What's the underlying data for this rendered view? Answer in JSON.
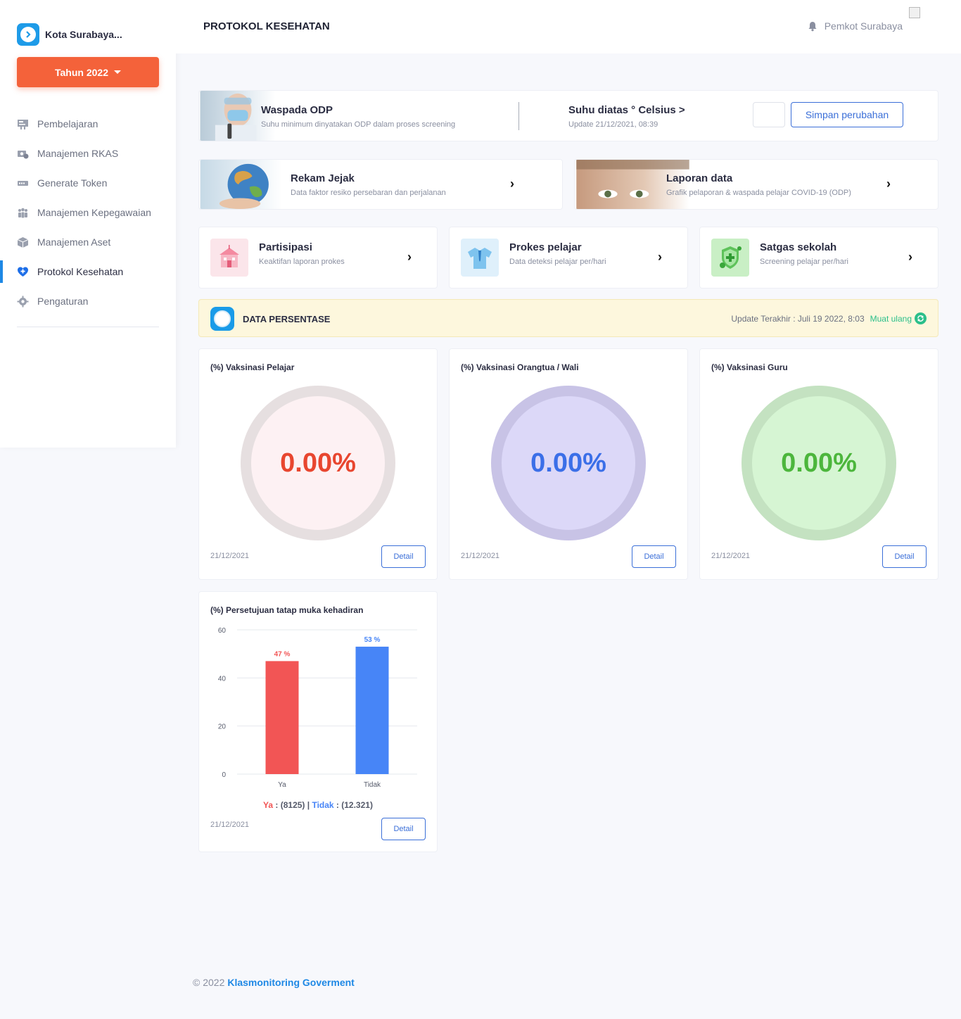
{
  "brand": {
    "name": "Kota Surabaya..."
  },
  "year_button": {
    "label": "Tahun 2022"
  },
  "sidebar": {
    "items": [
      {
        "label": "Pembelajaran",
        "icon": "board-icon",
        "active": false
      },
      {
        "label": "Manajemen RKAS",
        "icon": "money-icon",
        "active": false
      },
      {
        "label": "Generate Token",
        "icon": "ticket-icon",
        "active": false
      },
      {
        "label": "Manajemen Kepegawaian",
        "icon": "people-icon",
        "active": false
      },
      {
        "label": "Manajemen Aset",
        "icon": "box-icon",
        "active": false
      },
      {
        "label": "Protokol Kesehatan",
        "icon": "heart-plus-icon",
        "active": true
      },
      {
        "label": "Pengaturan",
        "icon": "gear-icon",
        "active": false
      }
    ]
  },
  "header": {
    "title": "PROTOKOL KESEHATAN",
    "user": "Pemkot Surabaya"
  },
  "odp": {
    "title": "Waspada ODP",
    "subtitle": "Suhu minimum dinyatakan ODP dalam proses screening",
    "temp_title": "Suhu diatas ° Celsius >",
    "temp_update": "Update 21/12/2021, 08:39",
    "input_value": "",
    "save_label": "Simpan perubahan"
  },
  "wide_cards": [
    {
      "title": "Rekam Jejak",
      "subtitle": "Data faktor resiko persebaran dan perjalanan"
    },
    {
      "title": "Laporan data",
      "subtitle": "Grafik pelaporan & waspada pelajar COVID-19 (ODP)"
    }
  ],
  "menu_cards": [
    {
      "title": "Partisipasi",
      "subtitle": "Keaktifan laporan prokes",
      "icon": "school-icon"
    },
    {
      "title": "Prokes pelajar",
      "subtitle": "Data deteksi pelajar per/hari",
      "icon": "shirt-icon"
    },
    {
      "title": "Satgas sekolah",
      "subtitle": "Screening pelajar per/hari",
      "icon": "shield-virus-icon"
    }
  ],
  "banner": {
    "title": "DATA PERSENTASE",
    "update": "Update Terakhir : Juli 19 2022, 8:03",
    "reload": "Muat ulang"
  },
  "gauges": [
    {
      "title": "(%) Vaksinasi Pelajar",
      "value": "0.00%",
      "date": "21/12/2021",
      "detail": "Detail",
      "colors": {
        "ring": "#e6dfe0",
        "fill": "#fdf1f3",
        "text": "#e8462f"
      }
    },
    {
      "title": "(%) Vaksinasi Orangtua / Wali",
      "value": "0.00%",
      "date": "21/12/2021",
      "detail": "Detail",
      "colors": {
        "ring": "#c8c3e6",
        "fill": "#dcd8f8",
        "text": "#3b6fe8"
      }
    },
    {
      "title": "(%) Vaksinasi Guru",
      "value": "0.00%",
      "date": "21/12/2021",
      "detail": "Detail",
      "colors": {
        "ring": "#c4e2c1",
        "fill": "#d6f5d3",
        "text": "#4cb63c"
      }
    }
  ],
  "attendance": {
    "title": "(%) Persetujuan tatap muka kehadiran",
    "legend_ya": "Ya",
    "legend_ya_value": " : (8125) | ",
    "legend_tidak": "Tidak",
    "legend_tidak_value": " : (12.321)",
    "date": "21/12/2021",
    "detail": "Detail"
  },
  "chart_data": {
    "type": "bar",
    "categories": [
      "Ya",
      "Tidak"
    ],
    "values": [
      47,
      53
    ],
    "data_labels": [
      "47 %",
      "53 %"
    ],
    "colors": [
      "#f25555",
      "#4785f7"
    ],
    "ylim": [
      0,
      60
    ],
    "yticks": [
      0,
      20,
      40,
      60
    ],
    "grid": true
  },
  "footer": {
    "copyright": "© 2022",
    "org": "Klasmonitoring Goverment"
  }
}
